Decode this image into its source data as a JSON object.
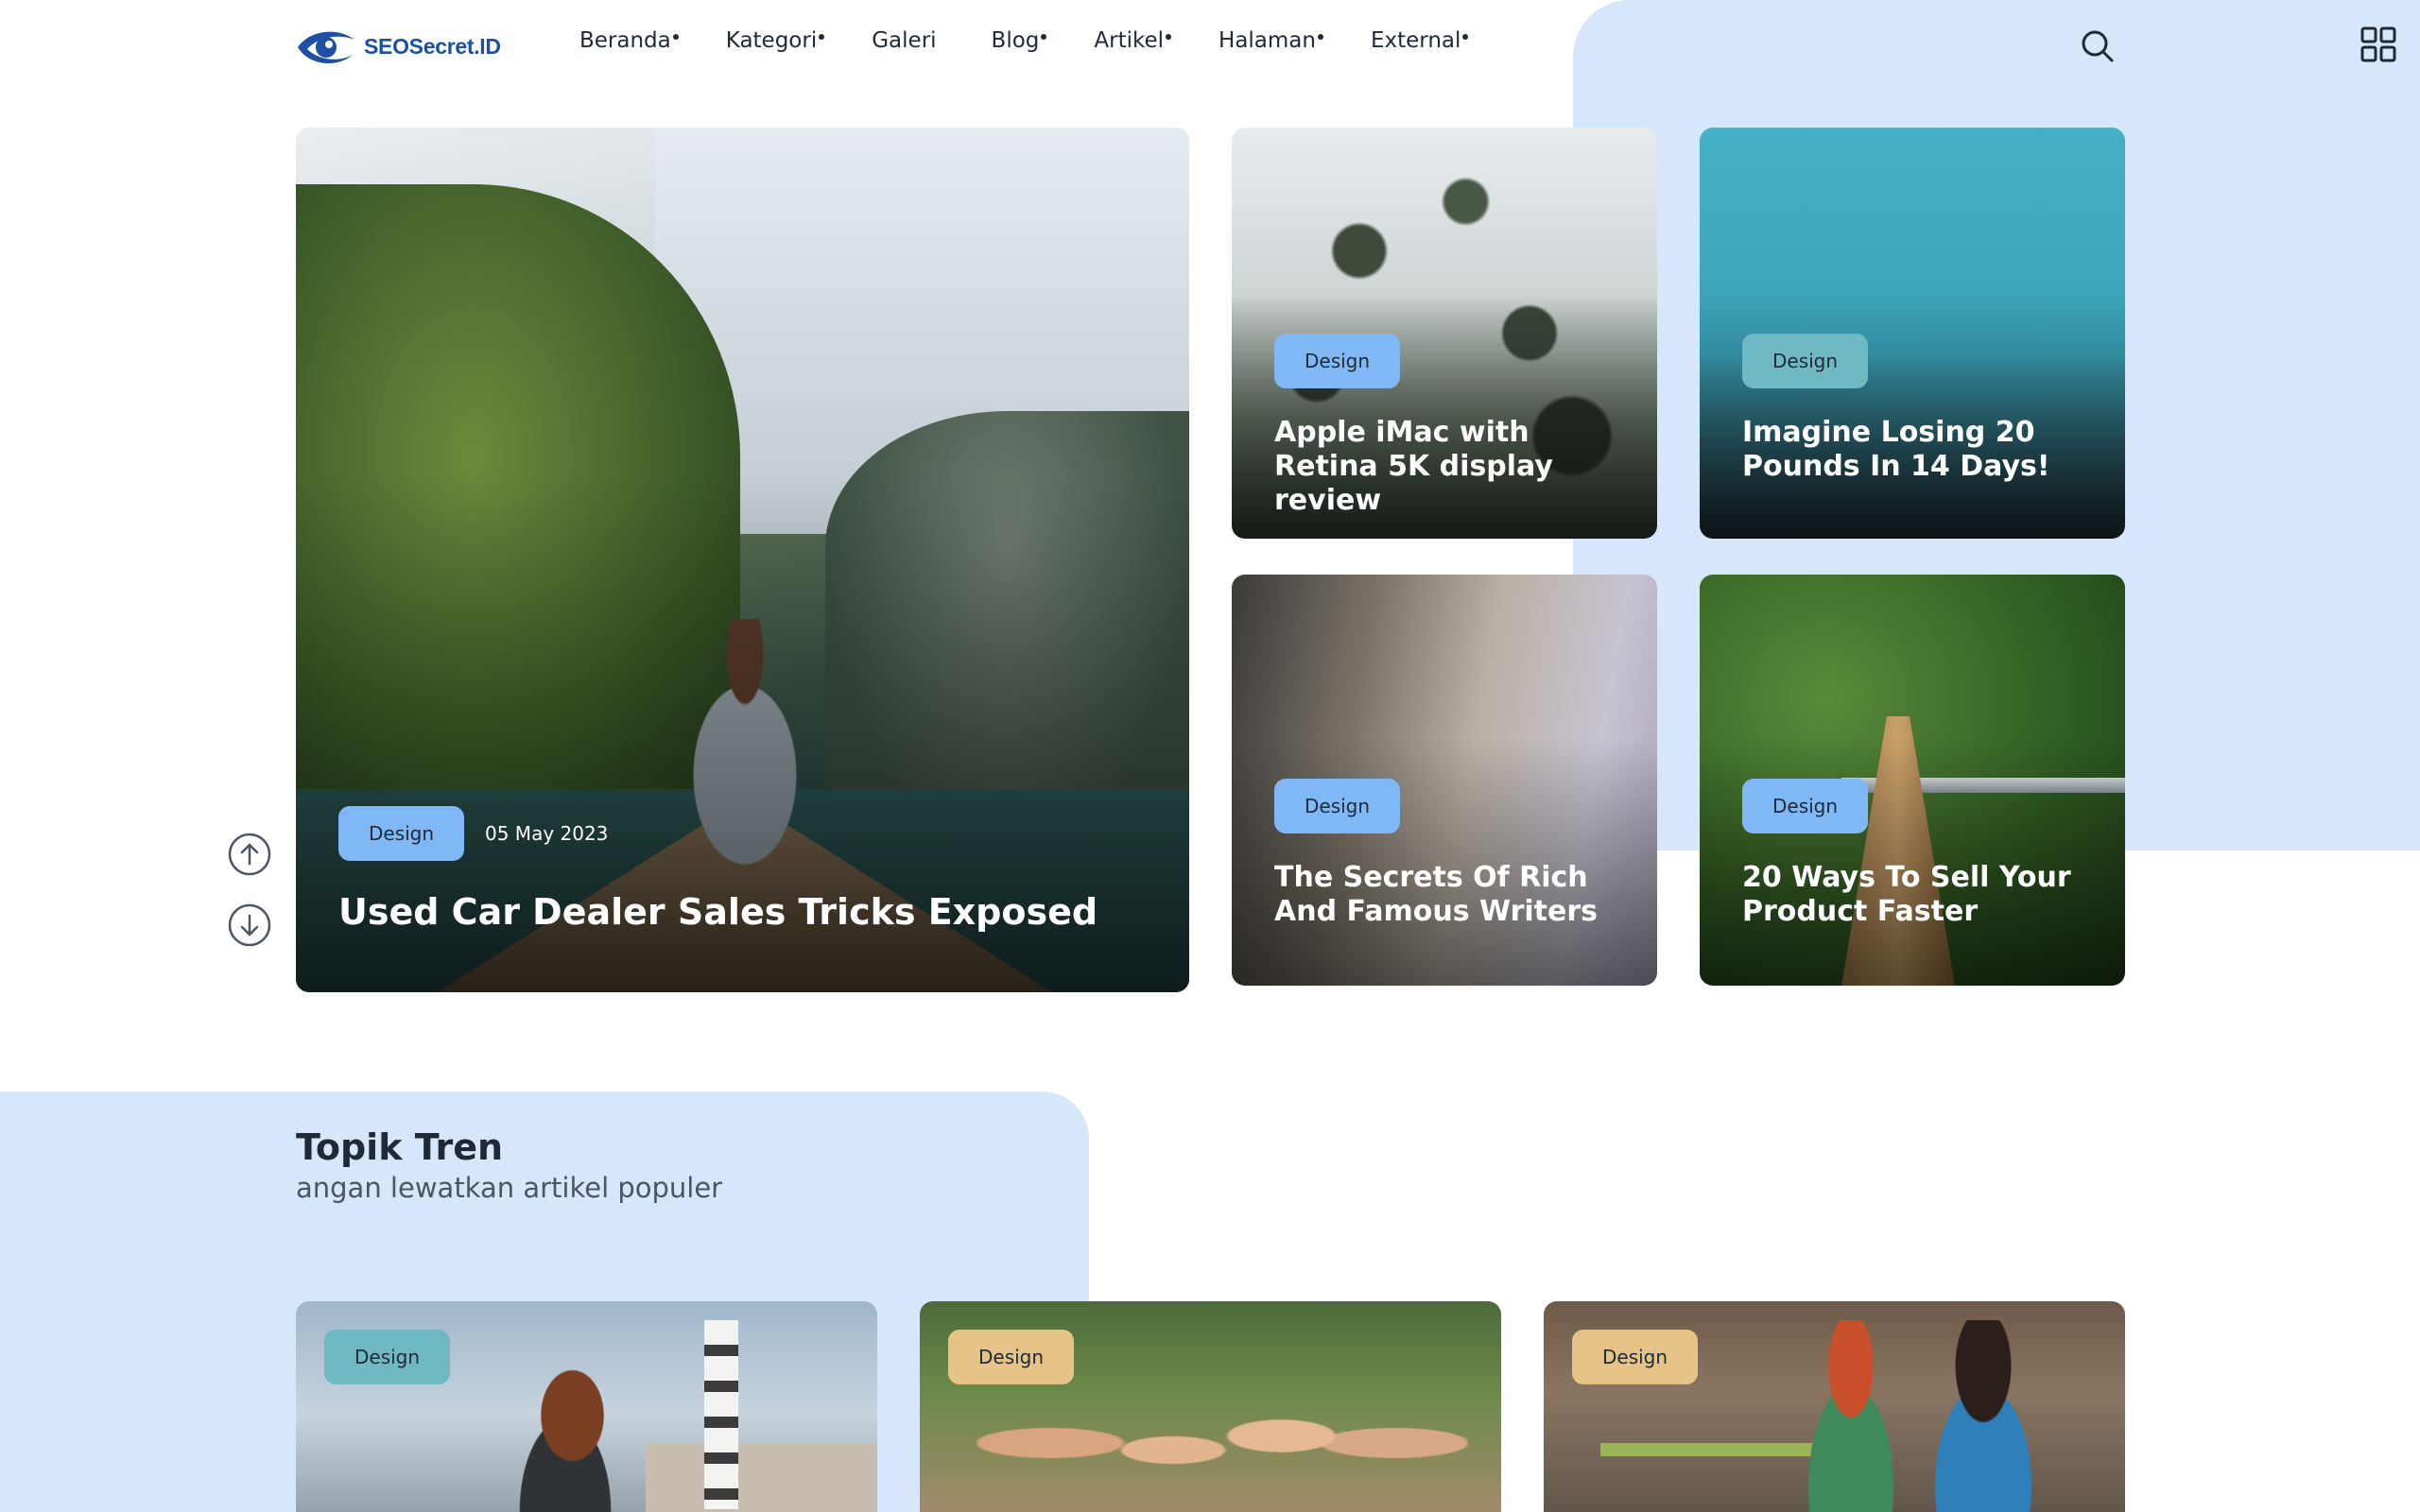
{
  "header": {
    "logo_text": "SEOSecret.ID",
    "nav": [
      {
        "label": "Beranda",
        "has_dot": true
      },
      {
        "label": "Kategori",
        "has_dot": true
      },
      {
        "label": "Galeri",
        "has_dot": false
      },
      {
        "label": "Blog",
        "has_dot": true
      },
      {
        "label": "Artikel",
        "has_dot": true
      },
      {
        "label": "Halaman",
        "has_dot": true
      },
      {
        "label": "External",
        "has_dot": true
      }
    ],
    "search_icon": "search-icon",
    "menu_icon": "grid-icon"
  },
  "hero": {
    "main": {
      "badge": "Design",
      "date": "05 May 2023",
      "title": "Used Car Dealer Sales Tricks Exposed"
    },
    "cards": [
      {
        "badge": "Design",
        "title": "Apple iMac with Retina 5K display review"
      },
      {
        "badge": "Design",
        "title": "Imagine Losing 20 Pounds In 14 Days!"
      },
      {
        "badge": "Design",
        "title": "The Secrets Of Rich And Famous Writers"
      },
      {
        "badge": "Design",
        "title": "20 Ways To Sell Your Product Faster"
      }
    ],
    "slider_controls": {
      "up_icon": "arrow-up-circle-icon",
      "down_icon": "arrow-down-circle-icon"
    }
  },
  "trending": {
    "title": "Topik Tren",
    "subtitle": "angan lewatkan artikel populer",
    "cards": [
      {
        "badge": "Design"
      },
      {
        "badge": "Design"
      },
      {
        "badge": "Design"
      }
    ]
  },
  "colors": {
    "accent_blue": "#7fb8f5",
    "accent_teal": "#6fb9c2",
    "accent_sand": "#e6c488",
    "bg_blob": "#d6e7fb",
    "logo": "#1d4fa3"
  }
}
